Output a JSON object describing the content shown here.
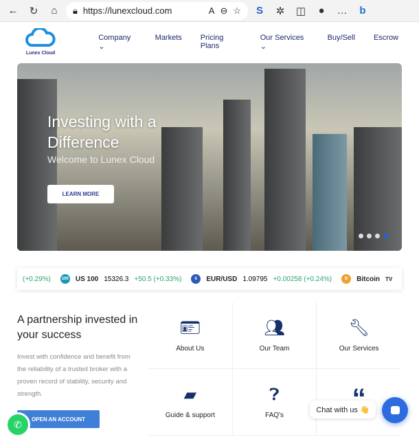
{
  "browser": {
    "url": "https://lunexcloud.com",
    "icons": [
      "back-icon",
      "refresh-icon",
      "home-icon",
      "lock-icon",
      "read-aloud-icon",
      "zoom-icon",
      "favorite-icon",
      "extension-icon",
      "split-icon",
      "profile-icon",
      "more-icon",
      "bing-icon"
    ]
  },
  "logo": {
    "text": "Lunex Cloud",
    "color": "#1e8fe0"
  },
  "nav": {
    "items": [
      "Company ⌄",
      "Markets",
      "Pricing Plans",
      "Our Services ⌄",
      "Buy/Sell",
      "Escrow"
    ]
  },
  "hero": {
    "title": "Investing with a Difference",
    "subtitle": "Welcome to Lunex Cloud",
    "button": "LEARN MORE",
    "slides": 4,
    "active_slide": 4
  },
  "ticker": {
    "items": [
      {
        "symbol": "",
        "price": "",
        "change": "(+0.29%)"
      },
      {
        "symbol": "US 100",
        "icon": "100",
        "price": "15326.3",
        "change": "+50.5 (+0.33%)"
      },
      {
        "symbol": "EUR/USD",
        "icon": "€",
        "price": "1.09795",
        "change": "+0.00258 (+0.24%)"
      },
      {
        "symbol": "Bitcoin",
        "icon": "B",
        "price": "",
        "change": ""
      }
    ],
    "brand": "TV"
  },
  "intro": {
    "heading": "A partnership invested in your success",
    "text": "Invest with confidence and benefit from the reliability of a trusted broker with a proven record of stability, security and strength.",
    "button": "OPEN AN ACCOUNT"
  },
  "features": [
    {
      "label": "About Us",
      "icon": "id-card-icon"
    },
    {
      "label": "Our Team",
      "icon": "users-icon"
    },
    {
      "label": "Our Services",
      "icon": "wrench-icon"
    },
    {
      "label": "Guide & support",
      "icon": "chat-icon"
    },
    {
      "label": "FAQ's",
      "icon": "question-icon"
    },
    {
      "label": "",
      "icon": "quote-icon"
    }
  ],
  "chat": {
    "label": "Chat with us 👋"
  }
}
